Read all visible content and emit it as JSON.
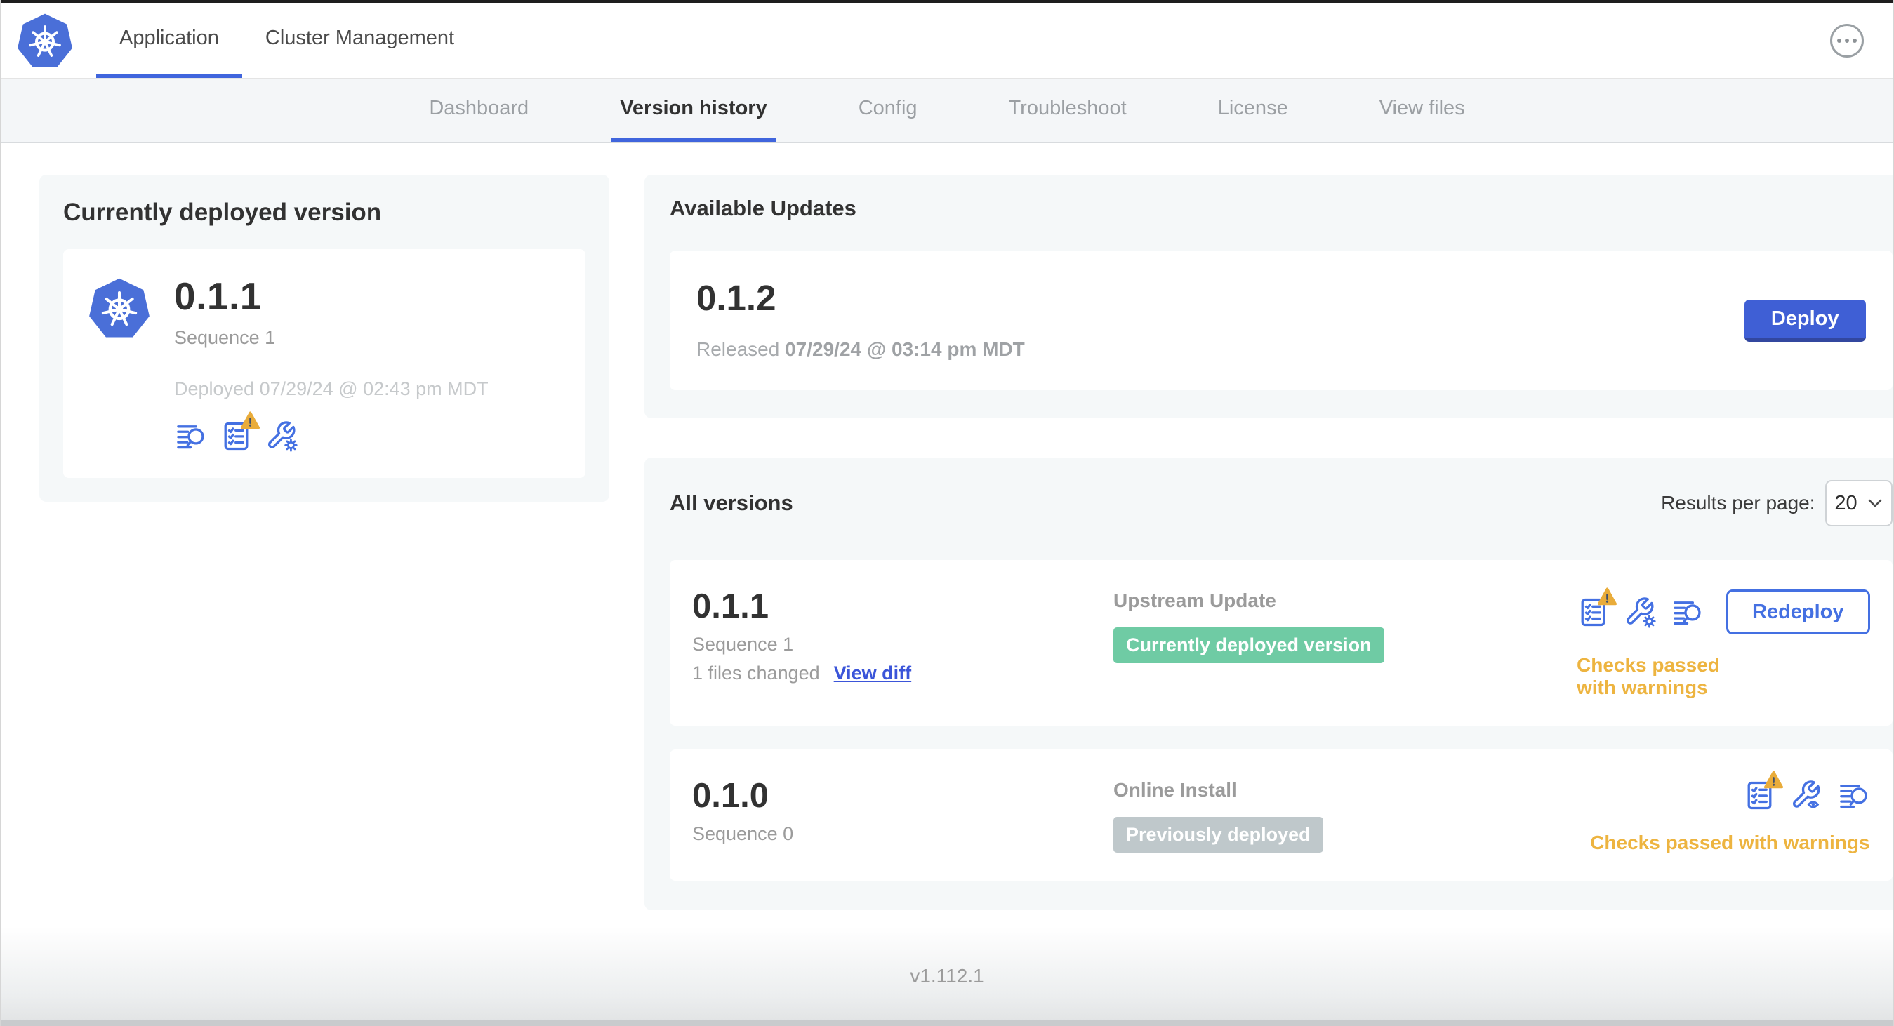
{
  "topnav": {
    "tabs": [
      {
        "label": "Application",
        "active": true
      },
      {
        "label": "Cluster Management",
        "active": false
      }
    ]
  },
  "subnav": {
    "tabs": [
      {
        "label": "Dashboard",
        "active": false
      },
      {
        "label": "Version history",
        "active": true
      },
      {
        "label": "Config",
        "active": false
      },
      {
        "label": "Troubleshoot",
        "active": false
      },
      {
        "label": "License",
        "active": false
      },
      {
        "label": "View files",
        "active": false
      }
    ]
  },
  "current_version": {
    "title": "Currently deployed version",
    "version": "0.1.1",
    "sequence": "Sequence 1",
    "deployed": "Deployed 07/29/24 @ 02:43 pm MDT"
  },
  "available_updates": {
    "title": "Available Updates",
    "version": "0.1.2",
    "released_prefix": "Released",
    "released_date": "07/29/24 @ 03:14 pm MDT",
    "deploy_label": "Deploy"
  },
  "all_versions": {
    "title": "All versions",
    "results_per_page_label": "Results per page:",
    "results_per_page_value": "20",
    "rows": [
      {
        "version": "0.1.1",
        "sequence": "Sequence 1",
        "files_changed": "1 files changed",
        "view_diff_label": "View diff",
        "source": "Upstream Update",
        "badge": "Currently deployed version",
        "badge_style": "background-color:#6fcba4",
        "status": "Checks passed with warnings",
        "action_label": "Redeploy"
      },
      {
        "version": "0.1.0",
        "sequence": "Sequence 0",
        "source": "Online Install",
        "badge": "Previously deployed",
        "badge_style": "background-color:#bfc8cb",
        "status": "Checks passed with warnings"
      }
    ]
  },
  "footer": {
    "app_version": "v1.112.1"
  },
  "icons": {
    "brand": "kubernetes-logo",
    "menu": "ellipsis-menu-icon",
    "release_notes": "release-notes-icon",
    "preflight": "preflight-checks-icon",
    "preflight_warning": "warning-triangle-icon",
    "edit_config": "edit-config-wrench-gear-icon",
    "view_config": "view-config-wrench-eye-icon",
    "results_chevron": "chevron-down-icon"
  },
  "colors": {
    "accent_blue": "#4470e2",
    "tab_underline_blue": "#4065dd",
    "k8s_logo_blue": "#4a6fd8",
    "deploy_button_blue": "#3f5fd5",
    "success_badge_green": "#6fcba4",
    "neutral_badge_gray": "#bfc8cb",
    "warning_amber": "#edb440",
    "heading_text": "#323232",
    "muted_text": "#9b9b9b",
    "panel_background": "#f5f8f9",
    "subnav_background": "#f4f6f8"
  }
}
